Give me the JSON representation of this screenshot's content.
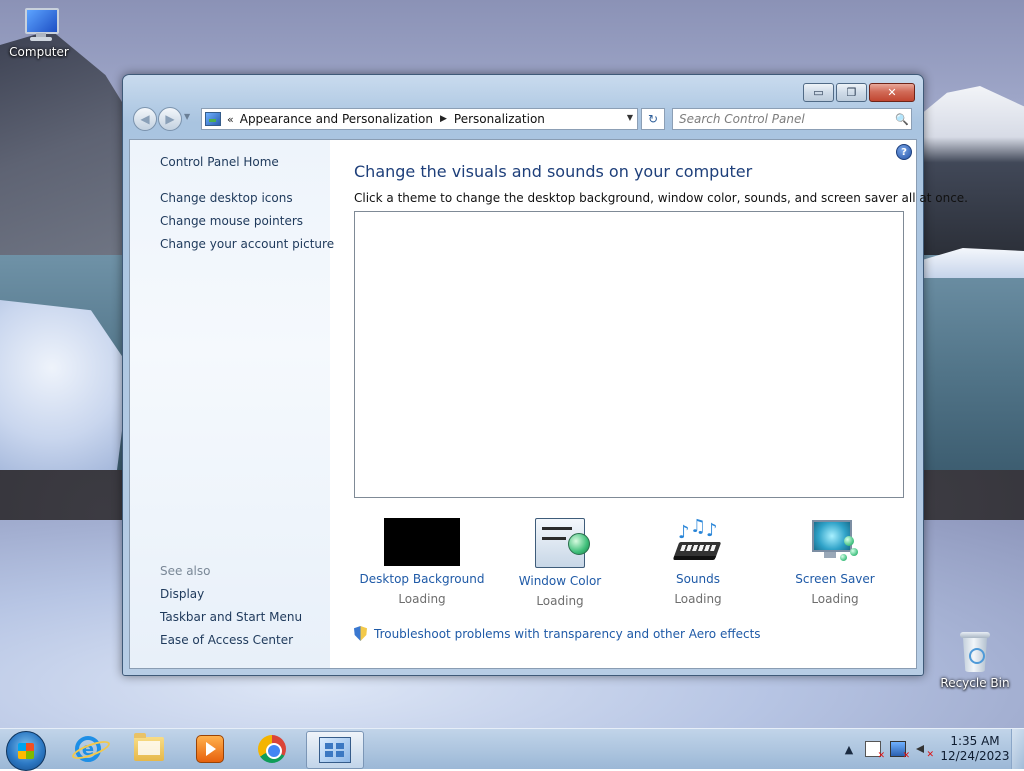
{
  "desktop": {
    "icons": [
      {
        "label": "Computer"
      },
      {
        "label": "Recycle Bin"
      }
    ]
  },
  "window": {
    "caption_buttons": {
      "minimize": "▭",
      "maximize": "❐",
      "close": "✕"
    },
    "nav": {
      "back_glyph": "◀",
      "forward_glyph": "▶",
      "breadcrumb_lead": "«",
      "breadcrumb": [
        "Appearance and Personalization",
        "Personalization"
      ],
      "breadcrumb_sep": "▶",
      "dropdown_glyph": "▼",
      "refresh_glyph": "↻",
      "search_placeholder": "Search Control Panel",
      "search_glyph": "🔍"
    },
    "left_pane": {
      "home": "Control Panel Home",
      "links": [
        "Change desktop icons",
        "Change mouse pointers",
        "Change your account picture"
      ],
      "see_also_title": "See also",
      "see_also": [
        "Display",
        "Taskbar and Start Menu",
        "Ease of Access Center"
      ]
    },
    "main": {
      "help_glyph": "?",
      "title": "Change the visuals and sounds on your computer",
      "subtitle": "Click a theme to change the desktop background, window color, sounds, and screen saver all at once.",
      "tiles": [
        {
          "label": "Desktop Background",
          "status": "Loading",
          "icon": "desktop-background-thumbnail"
        },
        {
          "label": "Window Color",
          "status": "Loading",
          "icon": "window-color-icon"
        },
        {
          "label": "Sounds",
          "status": "Loading",
          "icon": "sounds-icon"
        },
        {
          "label": "Screen Saver",
          "status": "Loading",
          "icon": "screen-saver-icon"
        }
      ],
      "troubleshoot_link": "Troubleshoot problems with transparency and other Aero effects"
    }
  },
  "taskbar": {
    "pinned": [
      {
        "name": "Internet Explorer",
        "icon": "ie-icon"
      },
      {
        "name": "Windows Explorer",
        "icon": "folder-icon"
      },
      {
        "name": "Windows Media Player",
        "icon": "media-player-icon"
      },
      {
        "name": "Google Chrome",
        "icon": "chrome-icon"
      },
      {
        "name": "Control Panel",
        "icon": "control-panel-icon",
        "active": true
      }
    ],
    "tray": {
      "overflow_glyph": "▲"
    },
    "clock": {
      "time": "1:35 AM",
      "date": "12/24/2023"
    }
  },
  "colors": {
    "link": "#1f5aa7",
    "title": "#1e3f7a",
    "nav_pane_link": "#1e395b"
  }
}
